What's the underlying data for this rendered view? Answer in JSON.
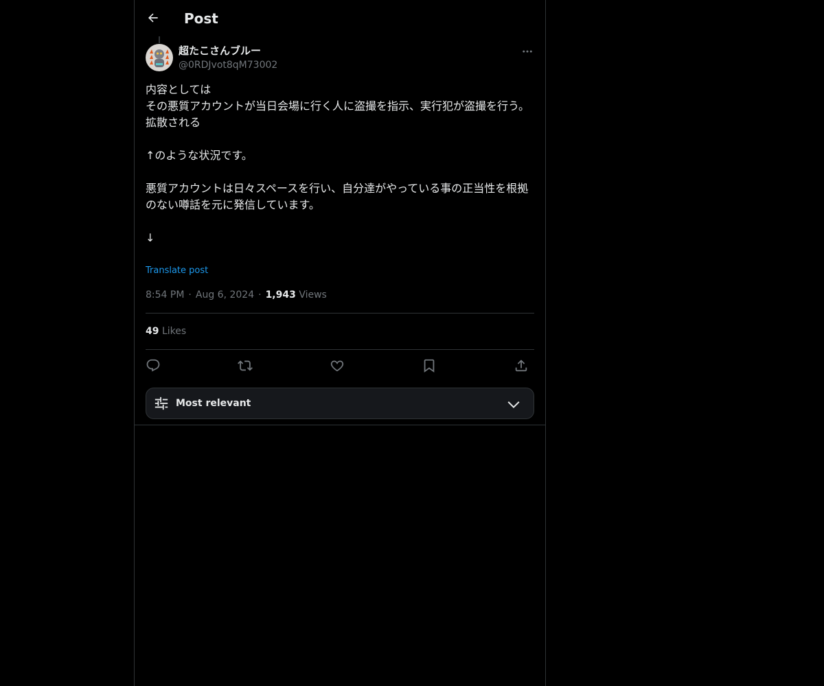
{
  "header": {
    "title": "Post",
    "back_icon": "arrow-left-icon"
  },
  "post": {
    "author": {
      "display_name": "超たこさんブルー",
      "handle": "@0RDJvot8qM73002"
    },
    "text": "内容としては\nその悪質アカウントが当日会場に行く人に盗撮を指示、実行犯が盗撮を行う。\n拡散される\n\n↑のような状況です。\n\n悪質アカウントは日々スペースを行い、自分達がやっている事の正当性を根拠のない噂話を元に発信しています。\n\n↓",
    "translate_label": "Translate post",
    "time": "8:54 PM",
    "date": "Aug 6, 2024",
    "separator": "·",
    "views_count": "1,943",
    "views_label": "Views",
    "likes_count": "49",
    "likes_label": "Likes"
  },
  "actions": [
    "reply-icon",
    "repost-icon",
    "like-icon",
    "bookmark-icon",
    "share-icon"
  ],
  "sort": {
    "label": "Most relevant"
  },
  "colors": {
    "background": "#000000",
    "text": "#e7e9ea",
    "muted": "#71767b",
    "link": "#1d9bf0",
    "border": "#2f3336"
  }
}
